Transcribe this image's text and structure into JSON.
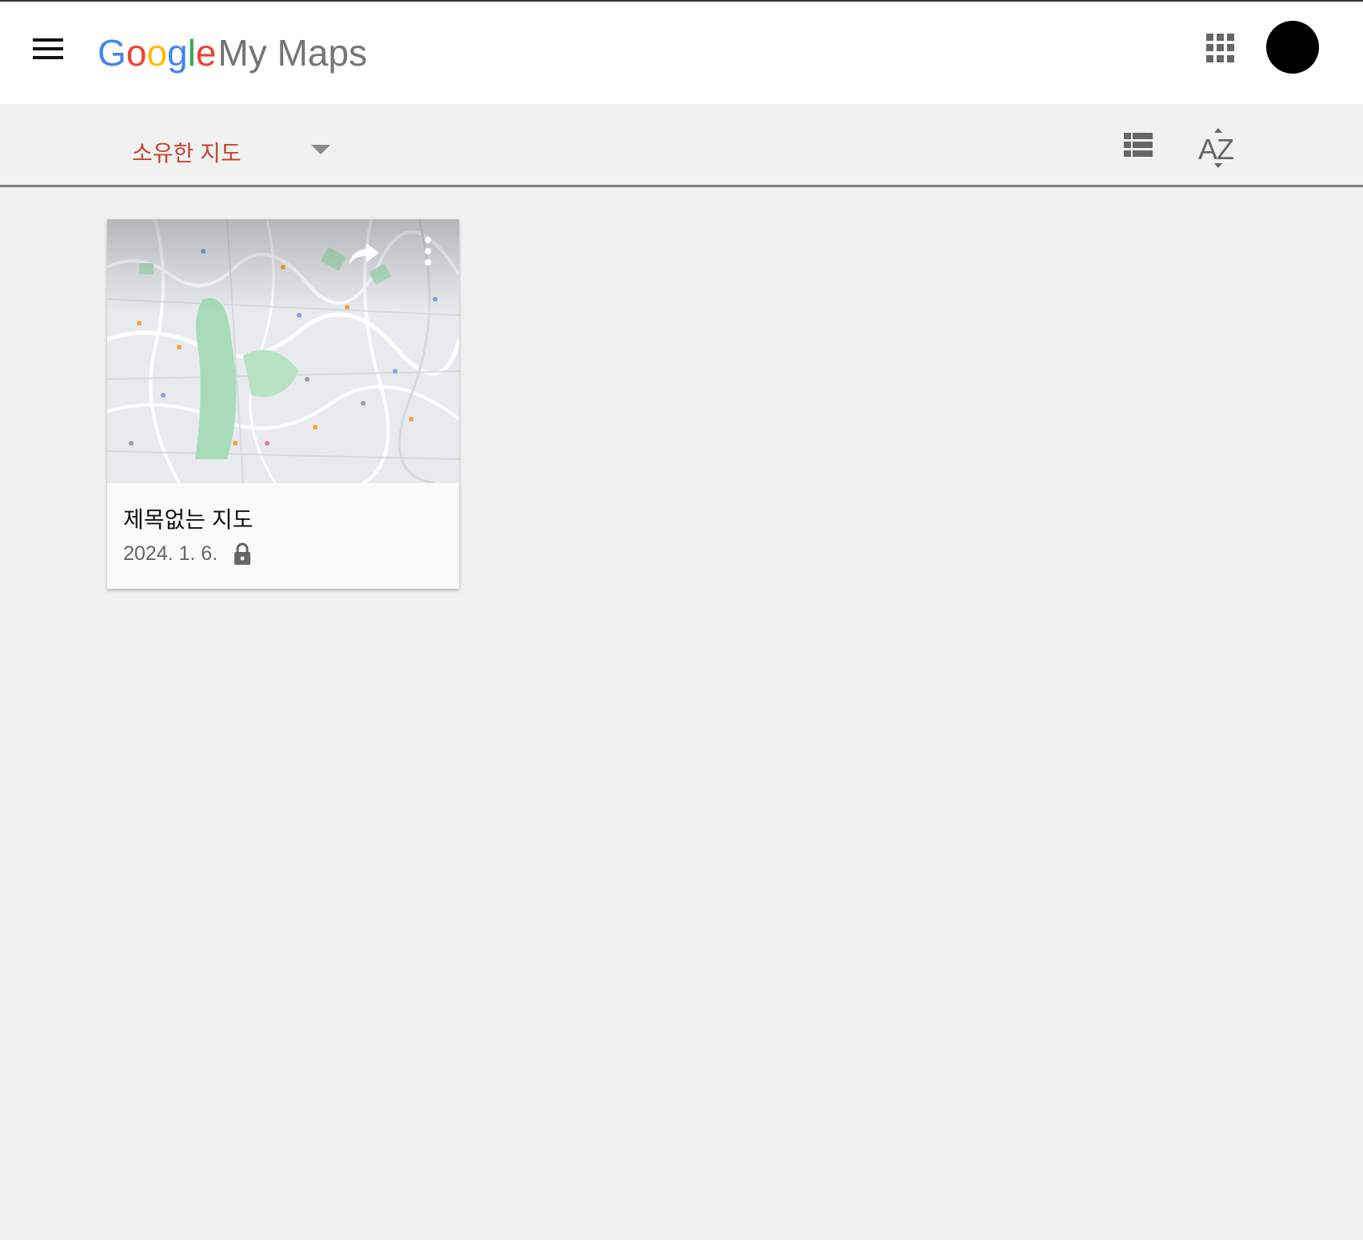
{
  "header": {
    "logo_letters": [
      {
        "char": "G",
        "color": "#4285F4"
      },
      {
        "char": "o",
        "color": "#EA4335"
      },
      {
        "char": "o",
        "color": "#FBBC05"
      },
      {
        "char": "g",
        "color": "#4285F4"
      },
      {
        "char": "l",
        "color": "#34A853"
      },
      {
        "char": "e",
        "color": "#EA4335"
      }
    ],
    "product_name": "My Maps",
    "menu_icon": "hamburger-menu-icon",
    "apps_icon": "apps-grid-icon",
    "avatar_color": "#000000"
  },
  "toolbar": {
    "filter_label": "소유한 지도",
    "filter_color": "#c5442f",
    "view_icon": "list-view-icon",
    "sort_icon": "sort-az-icon",
    "sort_label": "AZ"
  },
  "maps": [
    {
      "title": "제목없는 지도",
      "date": "2024. 1. 6.",
      "visibility_icon": "lock-icon",
      "share_icon": "share-arrow-icon",
      "more_icon": "more-vert-icon"
    }
  ]
}
